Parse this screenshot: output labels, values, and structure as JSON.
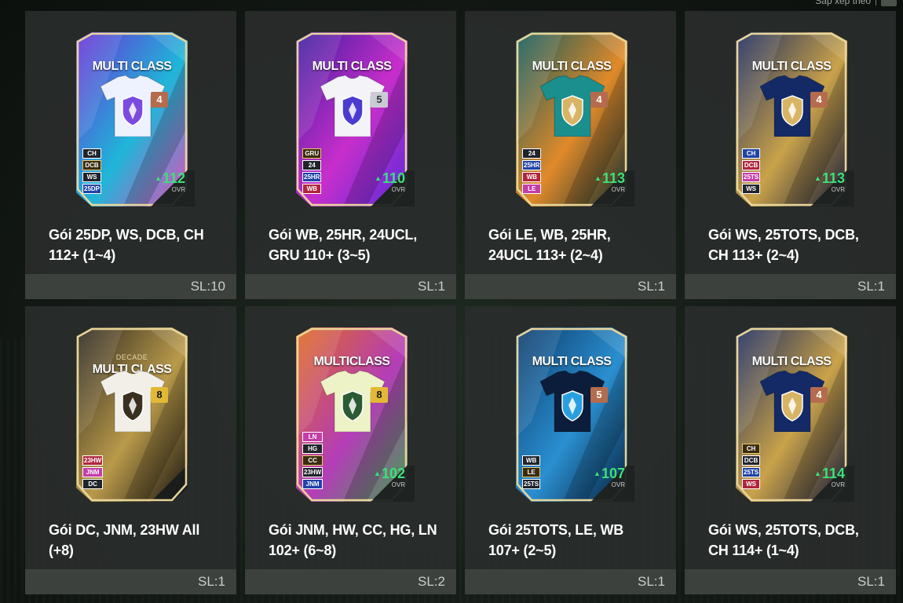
{
  "topbar": {
    "text": "Sắp xếp theo",
    "button": ""
  },
  "packs": [
    {
      "title": "Gói 25DP, WS, DCB, CH 112+ (1~4)",
      "count": "SL:10",
      "card_label": "MULTI CLASS",
      "card_sub": "",
      "rank": "4",
      "ovr": "112",
      "ovr_label": "OVR",
      "positions": [
        "CH",
        "DCB",
        "WS",
        "25DP"
      ],
      "colors": {
        "bg1": "#6a2fd6",
        "bg2": "#1fb6d9",
        "bg3": "#e24db8",
        "shirt": "#eef2ff",
        "emblem": "#7b4be0",
        "rank_bg": "#b56b4d"
      }
    },
    {
      "title": "Gói WB, 25HR, 24UCL, GRU 110+ (3~5)",
      "count": "SL:1",
      "card_label": "MULTI CLASS",
      "card_sub": "",
      "rank": "5",
      "ovr": "110",
      "ovr_label": "OVR",
      "positions": [
        "GRU",
        "24",
        "25HR",
        "WB"
      ],
      "colors": {
        "bg1": "#3c1e9e",
        "bg2": "#c72ecb",
        "bg3": "#5a2bd9",
        "shirt": "#f3f3f8",
        "emblem": "#4b3bd0",
        "rank_bg": "#c9ccd4"
      }
    },
    {
      "title": "Gói LE, WB, 25HR, 24UCL 113+ (2~4)",
      "count": "SL:1",
      "card_label": "MULTI CLASS",
      "card_sub": "",
      "rank": "4",
      "ovr": "113",
      "ovr_label": "OVR",
      "positions": [
        "24",
        "25HR",
        "WB",
        "LE"
      ],
      "colors": {
        "bg1": "#0e5a5d",
        "bg2": "#e08a2a",
        "bg3": "#0b2b2f",
        "shirt": "#1b8e8e",
        "emblem": "#d8b465",
        "rank_bg": "#b56b4d"
      }
    },
    {
      "title": "Gói WS, 25TOTS, DCB, CH 113+ (2~4)",
      "count": "SL:1",
      "card_label": "MULTI CLASS",
      "card_sub": "",
      "rank": "4",
      "ovr": "113",
      "ovr_label": "OVR",
      "positions": [
        "CH",
        "DCB",
        "25TS",
        "WS"
      ],
      "colors": {
        "bg1": "#1a2a5e",
        "bg2": "#c9a24a",
        "bg3": "#0f1638",
        "shirt": "#132a66",
        "emblem": "#d8b465",
        "rank_bg": "#b56b4d"
      }
    },
    {
      "title": "Gói DC, JNM, 23HW All (+8)",
      "count": "SL:1",
      "card_label": "MULTI CLASS",
      "card_sub": "DECADE",
      "rank": "8",
      "ovr": "",
      "ovr_label": "",
      "positions": [
        "23HW",
        "JNM",
        "DC"
      ],
      "colors": {
        "bg1": "#2a2520",
        "bg2": "#b99a4a",
        "bg3": "#151210",
        "shirt": "#f2efe8",
        "emblem": "#3a3020",
        "rank_bg": "#e2b936"
      }
    },
    {
      "title": "Gói JNM, HW, CC, HG, LN 102+ (6~8)",
      "count": "SL:2",
      "card_label": "MULTICLASS",
      "card_sub": "",
      "rank": "8",
      "ovr": "102",
      "ovr_label": "OVR",
      "positions": [
        "LN",
        "HG",
        "CC",
        "23HW",
        "JNM"
      ],
      "colors": {
        "bg1": "#e06a1e",
        "bg2": "#b43db8",
        "bg3": "#3fa14f",
        "shirt": "#eef2c7",
        "emblem": "#2b5a33",
        "rank_bg": "#e2b936"
      }
    },
    {
      "title": "Gói 25TOTS, LE, WB 107+ (2~5)",
      "count": "SL:1",
      "card_label": "MULTI CLASS",
      "card_sub": "",
      "rank": "5",
      "ovr": "107",
      "ovr_label": "OVR",
      "positions": [
        "WB",
        "LE",
        "25TS"
      ],
      "colors": {
        "bg1": "#0c3a6a",
        "bg2": "#2a8fd0",
        "bg3": "#061e3a",
        "shirt": "#0b1d3a",
        "emblem": "#2a9fe0",
        "rank_bg": "#b56b4d"
      }
    },
    {
      "title": "Gói WS, 25TOTS, DCB, CH 114+ (1~4)",
      "count": "SL:1",
      "card_label": "MULTI CLASS",
      "card_sub": "",
      "rank": "4",
      "ovr": "114",
      "ovr_label": "OVR",
      "positions": [
        "CH",
        "DCB",
        "25TS",
        "WS"
      ],
      "colors": {
        "bg1": "#1a2a5e",
        "bg2": "#c9a24a",
        "bg3": "#0f1638",
        "shirt": "#132a66",
        "emblem": "#d8b465",
        "rank_bg": "#b56b4d"
      }
    }
  ]
}
